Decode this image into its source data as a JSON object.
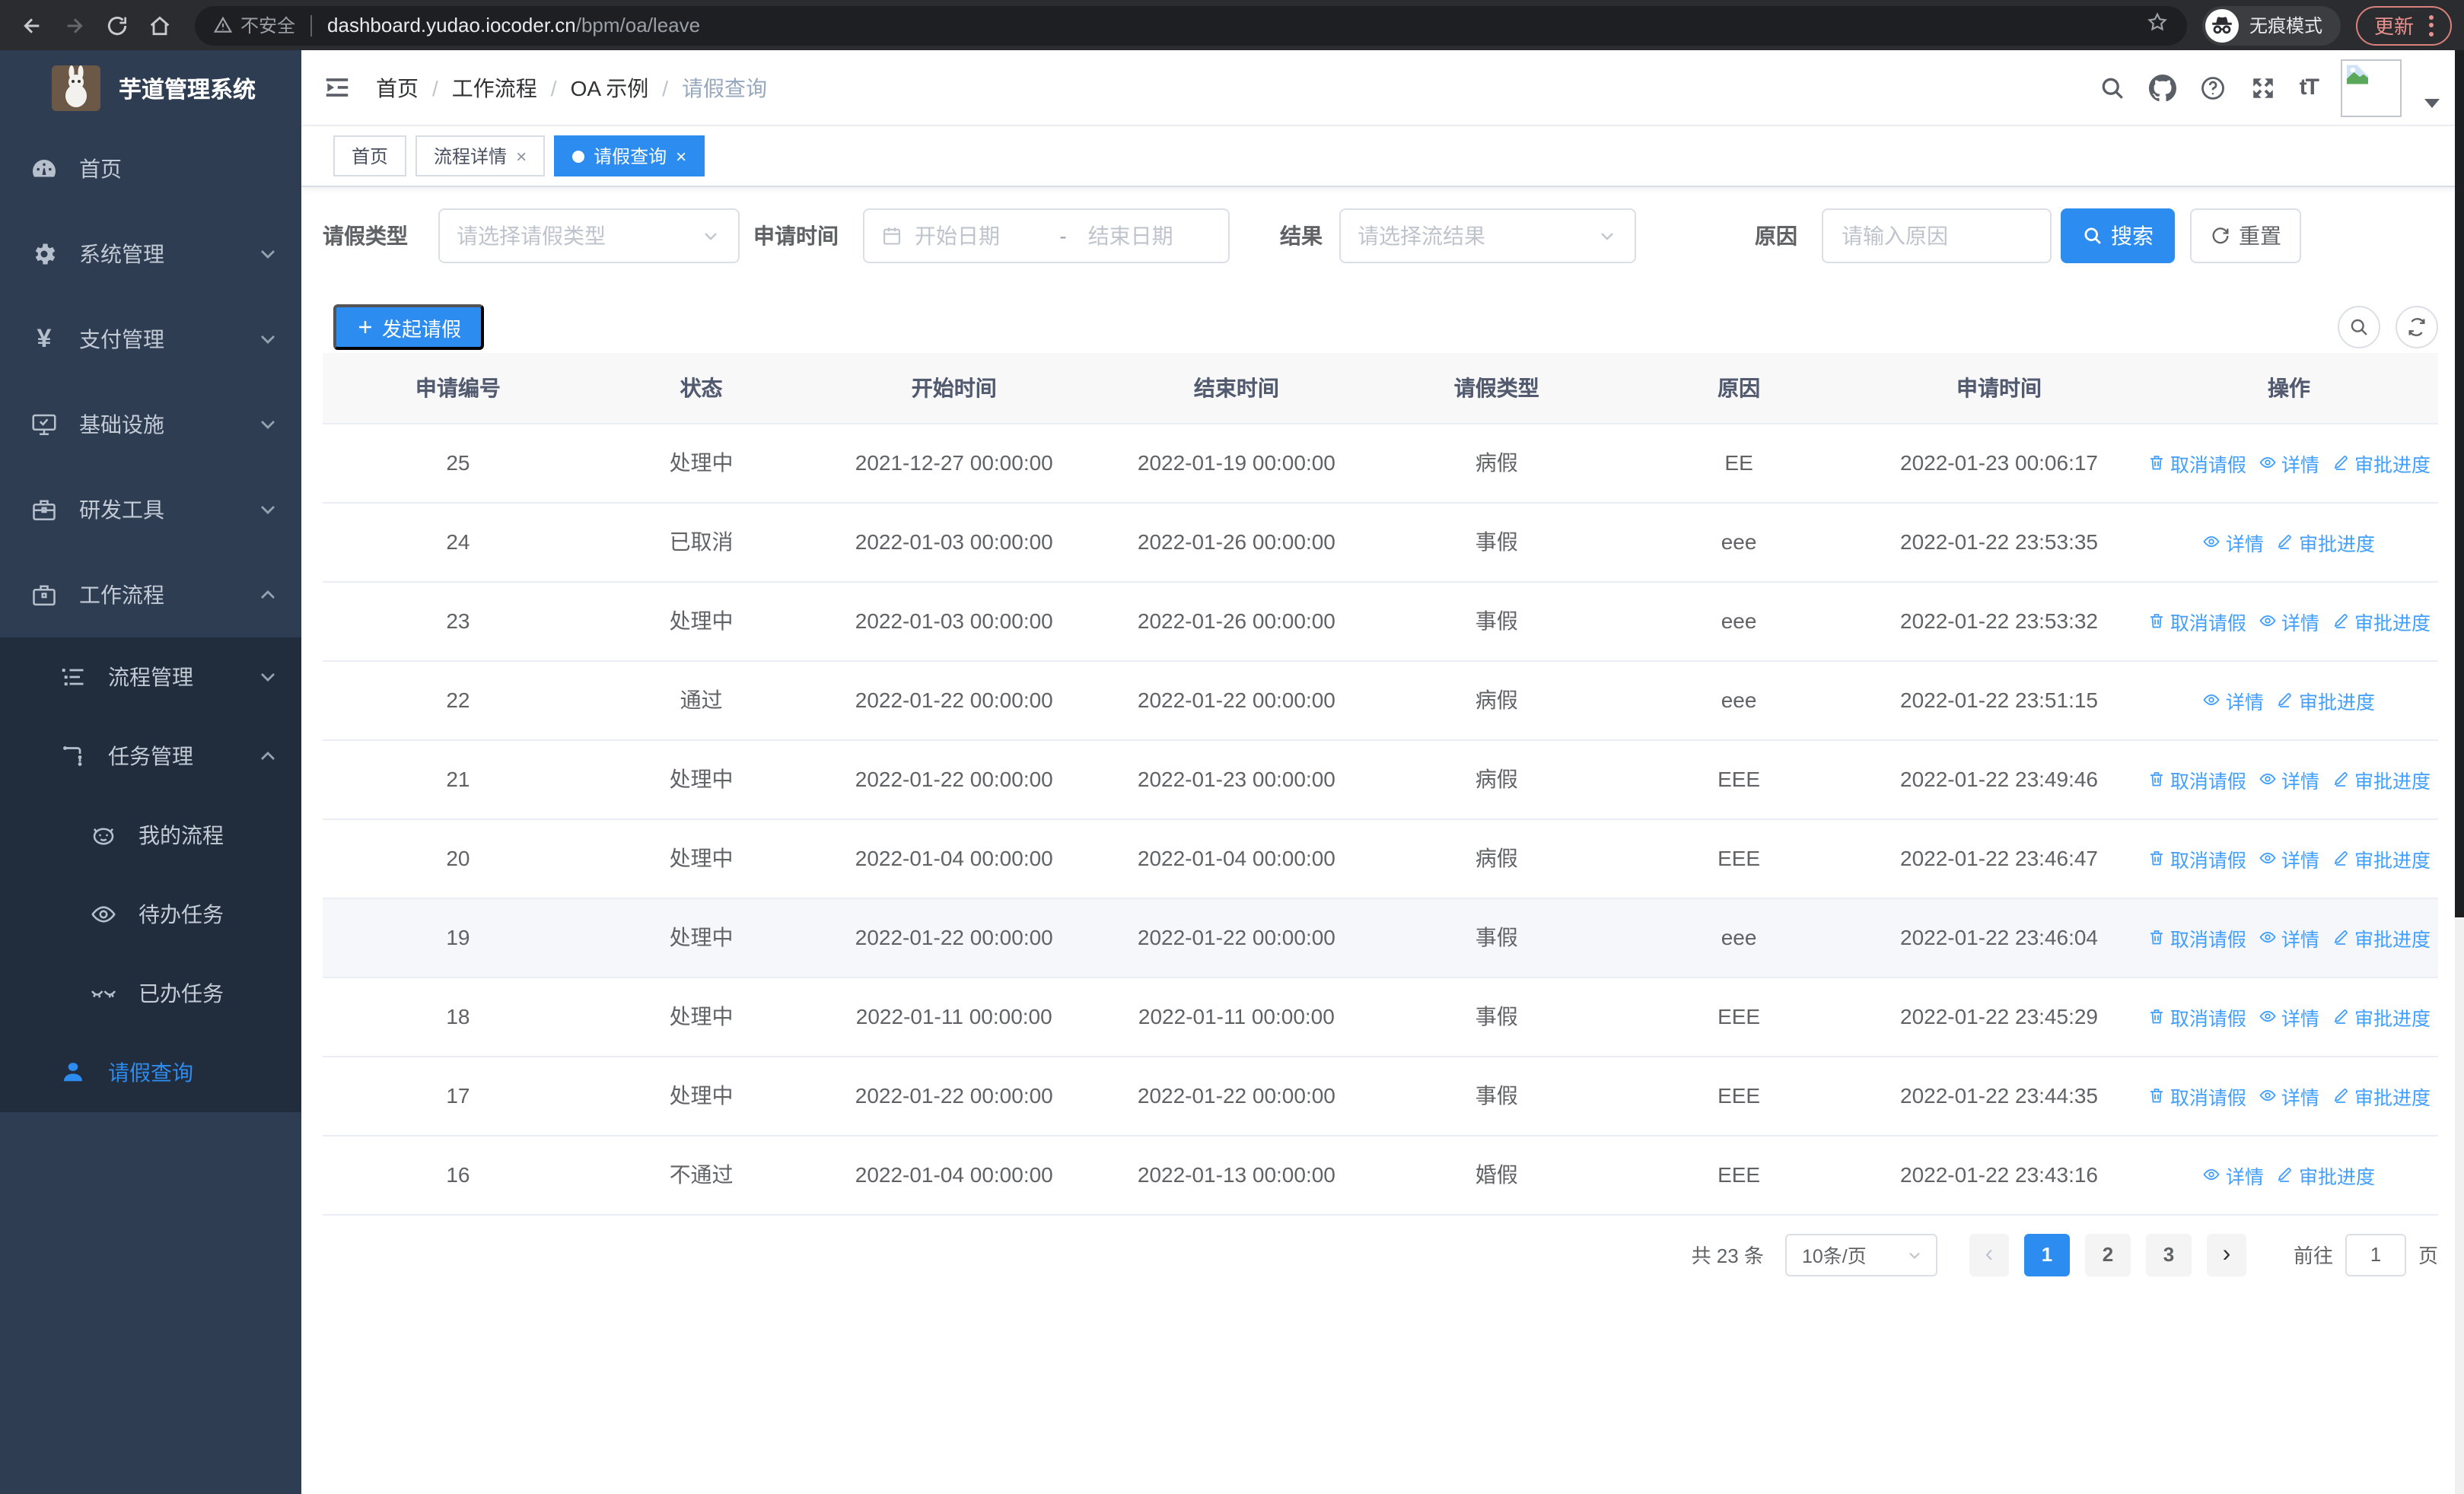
{
  "browser": {
    "security_label": "不安全",
    "url_host": "dashboard.yudao.iocoder.cn",
    "url_path": "/bpm/oa/leave",
    "incognito_label": "无痕模式",
    "update_label": "更新"
  },
  "sidebar": {
    "app_title": "芋道管理系统",
    "items": [
      {
        "label": "首页"
      },
      {
        "label": "系统管理"
      },
      {
        "label": "支付管理"
      },
      {
        "label": "基础设施"
      },
      {
        "label": "研发工具"
      },
      {
        "label": "工作流程"
      },
      {
        "label": "流程管理"
      },
      {
        "label": "任务管理"
      },
      {
        "label": "我的流程"
      },
      {
        "label": "待办任务"
      },
      {
        "label": "已办任务"
      },
      {
        "label": "请假查询"
      }
    ]
  },
  "header": {
    "breadcrumb": [
      "首页",
      "工作流程",
      "OA 示例",
      "请假查询"
    ]
  },
  "tabs": [
    {
      "label": "首页"
    },
    {
      "label": "流程详情"
    },
    {
      "label": "请假查询"
    }
  ],
  "filters": {
    "leave_type_label": "请假类型",
    "leave_type_placeholder": "请选择请假类型",
    "apply_time_label": "申请时间",
    "start_date_placeholder": "开始日期",
    "range_separator": "-",
    "end_date_placeholder": "结束日期",
    "result_label": "结果",
    "result_placeholder": "请选择流结果",
    "reason_label": "原因",
    "reason_placeholder": "请输入原因",
    "search_label": "搜索",
    "reset_label": "重置"
  },
  "toolbar": {
    "create_label": "发起请假"
  },
  "table": {
    "columns": [
      "申请编号",
      "状态",
      "开始时间",
      "结束时间",
      "请假类型",
      "原因",
      "申请时间",
      "操作"
    ],
    "action_labels": {
      "cancel": "取消请假",
      "detail": "详情",
      "progress": "审批进度"
    },
    "rows": [
      {
        "id": "25",
        "status": "处理中",
        "start": "2021-12-27 00:00:00",
        "end": "2022-01-19 00:00:00",
        "type": "病假",
        "reason": "EE",
        "applied": "2022-01-23 00:06:17",
        "actions": [
          "cancel",
          "detail",
          "progress"
        ],
        "highlight": false
      },
      {
        "id": "24",
        "status": "已取消",
        "start": "2022-01-03 00:00:00",
        "end": "2022-01-26 00:00:00",
        "type": "事假",
        "reason": "eee",
        "applied": "2022-01-22 23:53:35",
        "actions": [
          "detail",
          "progress"
        ],
        "highlight": false
      },
      {
        "id": "23",
        "status": "处理中",
        "start": "2022-01-03 00:00:00",
        "end": "2022-01-26 00:00:00",
        "type": "事假",
        "reason": "eee",
        "applied": "2022-01-22 23:53:32",
        "actions": [
          "cancel",
          "detail",
          "progress"
        ],
        "highlight": false
      },
      {
        "id": "22",
        "status": "通过",
        "start": "2022-01-22 00:00:00",
        "end": "2022-01-22 00:00:00",
        "type": "病假",
        "reason": "eee",
        "applied": "2022-01-22 23:51:15",
        "actions": [
          "detail",
          "progress"
        ],
        "highlight": false
      },
      {
        "id": "21",
        "status": "处理中",
        "start": "2022-01-22 00:00:00",
        "end": "2022-01-23 00:00:00",
        "type": "病假",
        "reason": "EEE",
        "applied": "2022-01-22 23:49:46",
        "actions": [
          "cancel",
          "detail",
          "progress"
        ],
        "highlight": false
      },
      {
        "id": "20",
        "status": "处理中",
        "start": "2022-01-04 00:00:00",
        "end": "2022-01-04 00:00:00",
        "type": "病假",
        "reason": "EEE",
        "applied": "2022-01-22 23:46:47",
        "actions": [
          "cancel",
          "detail",
          "progress"
        ],
        "highlight": false
      },
      {
        "id": "19",
        "status": "处理中",
        "start": "2022-01-22 00:00:00",
        "end": "2022-01-22 00:00:00",
        "type": "事假",
        "reason": "eee",
        "applied": "2022-01-22 23:46:04",
        "actions": [
          "cancel",
          "detail",
          "progress"
        ],
        "highlight": true
      },
      {
        "id": "18",
        "status": "处理中",
        "start": "2022-01-11 00:00:00",
        "end": "2022-01-11 00:00:00",
        "type": "事假",
        "reason": "EEE",
        "applied": "2022-01-22 23:45:29",
        "actions": [
          "cancel",
          "detail",
          "progress"
        ],
        "highlight": false
      },
      {
        "id": "17",
        "status": "处理中",
        "start": "2022-01-22 00:00:00",
        "end": "2022-01-22 00:00:00",
        "type": "事假",
        "reason": "EEE",
        "applied": "2022-01-22 23:44:35",
        "actions": [
          "cancel",
          "detail",
          "progress"
        ],
        "highlight": false
      },
      {
        "id": "16",
        "status": "不通过",
        "start": "2022-01-04 00:00:00",
        "end": "2022-01-13 00:00:00",
        "type": "婚假",
        "reason": "EEE",
        "applied": "2022-01-22 23:43:16",
        "actions": [
          "detail",
          "progress"
        ],
        "highlight": false
      }
    ]
  },
  "pagination": {
    "total_text": "共 23 条",
    "page_size": "10条/页",
    "prev_label": "‹",
    "pages": [
      "1",
      "2",
      "3"
    ],
    "active_page": "1",
    "next_label": "›",
    "goto_label": "前往",
    "goto_value": "1",
    "goto_unit": "页"
  },
  "colors": {
    "accent": "#2d8cf0",
    "link": "#409eff",
    "sidebar_bg": "#2f3d52",
    "submenu_bg": "#212c3c"
  }
}
